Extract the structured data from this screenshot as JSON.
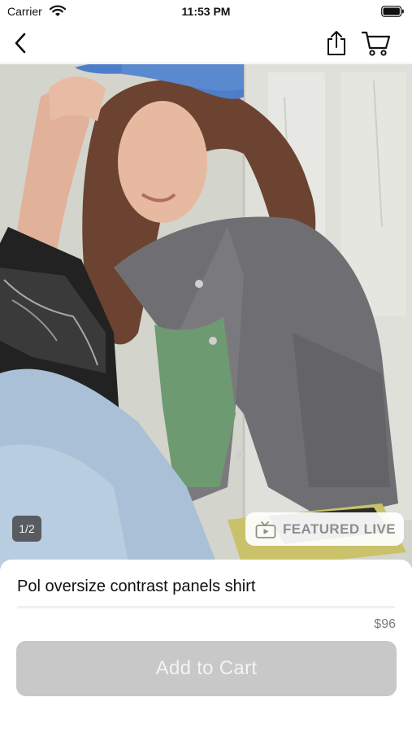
{
  "status_bar": {
    "carrier": "Carrier",
    "time": "11:53 PM"
  },
  "nav": {
    "back_icon": "chevron-left-icon",
    "share_icon": "share-icon",
    "cart_icon": "cart-icon"
  },
  "gallery": {
    "counter": "1/2",
    "featured_label": "FEATURED LIVE",
    "featured_icon": "tv-play-icon"
  },
  "product": {
    "title": "Pol oversize contrast panels shirt",
    "price": "$96",
    "add_to_cart_label": "Add to Cart"
  },
  "colors": {
    "button_disabled": "#c8c8c8",
    "badge_text": "#8e8e8e"
  }
}
